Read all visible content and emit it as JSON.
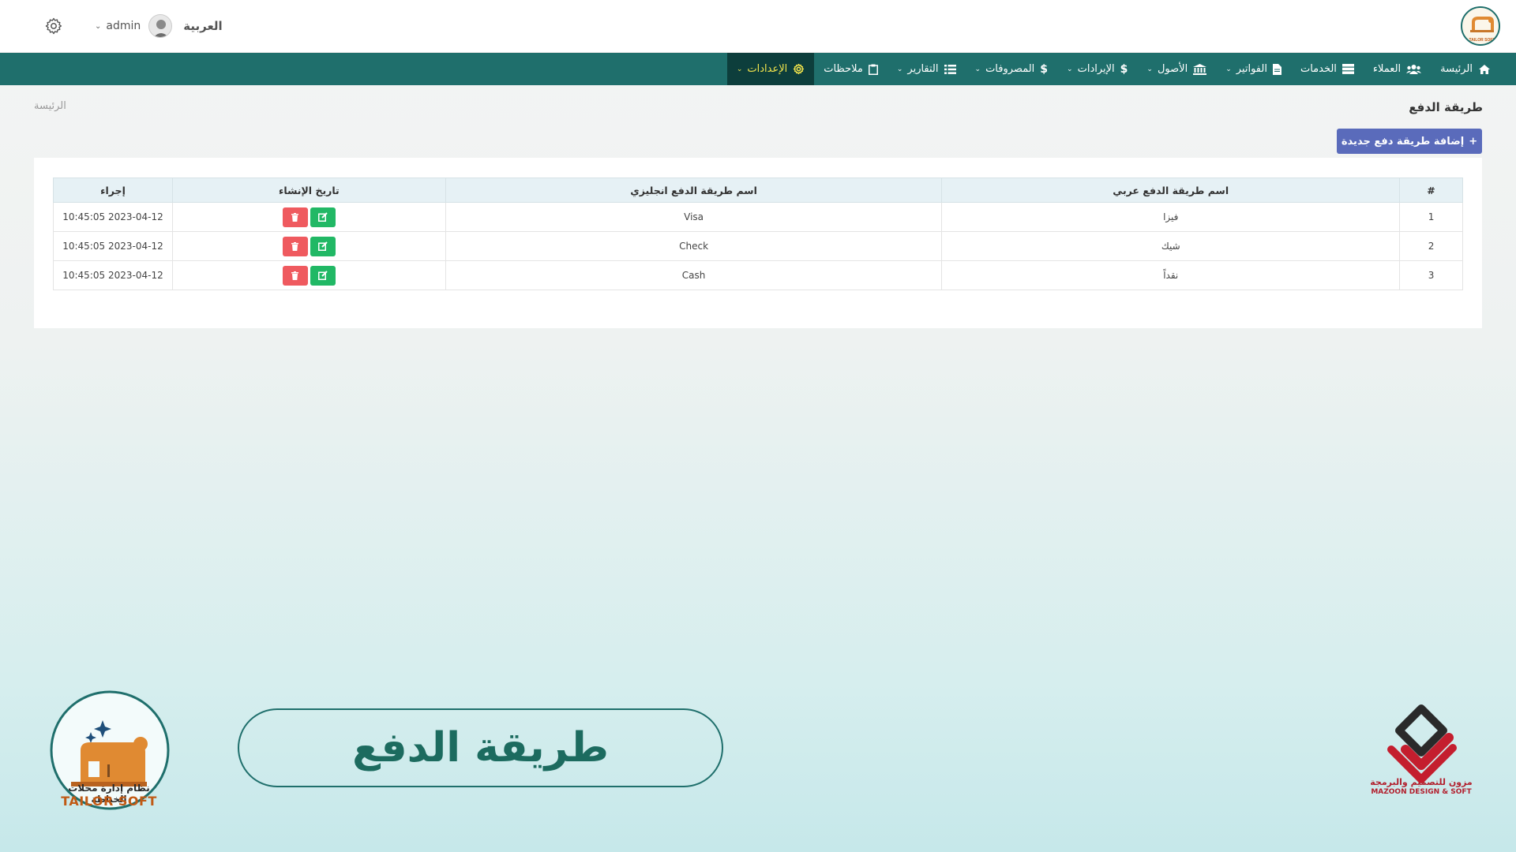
{
  "header": {
    "language": "العربية",
    "user": "admin",
    "logo_text": "TAILOR SOFT"
  },
  "nav": {
    "items": [
      {
        "label": "الرئيسة",
        "icon": "home-icon",
        "dropdown": false,
        "active": false
      },
      {
        "label": "العملاء",
        "icon": "users-icon",
        "dropdown": false,
        "active": false
      },
      {
        "label": "الخدمات",
        "icon": "list-icon",
        "dropdown": false,
        "active": false
      },
      {
        "label": "الفواتير",
        "icon": "file-icon",
        "dropdown": true,
        "active": false
      },
      {
        "label": "الأصول",
        "icon": "bank-icon",
        "dropdown": true,
        "active": false
      },
      {
        "label": "الإيرادات",
        "icon": "dollar-icon",
        "dropdown": true,
        "active": false
      },
      {
        "label": "المصروفات",
        "icon": "dollar-icon",
        "dropdown": true,
        "active": false
      },
      {
        "label": "التقارير",
        "icon": "tasks-icon",
        "dropdown": true,
        "active": false
      },
      {
        "label": "ملاحظات",
        "icon": "clipboard-icon",
        "dropdown": false,
        "active": false
      },
      {
        "label": "الإعدادات",
        "icon": "gear-icon",
        "dropdown": true,
        "active": true
      }
    ]
  },
  "page": {
    "title": "طريقة الدفع",
    "breadcrumb": "الرئيسة",
    "add_button": "إضافة طريقة دفع جديدة"
  },
  "table": {
    "headers": [
      "#",
      "اسم طريقة الدفع عربي",
      "اسم طريقة الدفع انجليزي",
      "تاريخ الإنشاء",
      "إجراء"
    ],
    "rows": [
      {
        "num": "1",
        "ar": "فيزا",
        "en": "Visa",
        "date": "2023-04-12 10:45:05"
      },
      {
        "num": "2",
        "ar": "شيك",
        "en": "Check",
        "date": "2023-04-12 10:45:05"
      },
      {
        "num": "3",
        "ar": "نقداً",
        "en": "Cash",
        "date": "2023-04-12 10:45:05"
      }
    ]
  },
  "branding": {
    "caption": "طريقة الدفع",
    "tailor_ar": "نظام إدارة محلات الخياطة",
    "tailor_en": "TAILOR SOFT",
    "mazoon_ar": "مزون للتصميم والبرمجة",
    "mazoon_en": "MAZOON DESIGN & SOFT"
  },
  "colors": {
    "nav_bg": "#1f6f6c",
    "nav_active_bg": "#0d3e3c",
    "nav_active_text": "#f3e54c",
    "add_button": "#5a6bbb",
    "delete_button": "#ef5a5f",
    "edit_button": "#21b865"
  }
}
